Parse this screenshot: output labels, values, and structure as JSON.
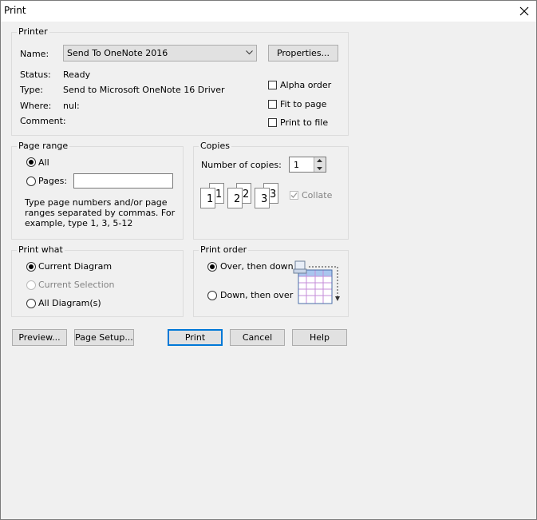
{
  "window": {
    "title": "Print"
  },
  "printer": {
    "group_label": "Printer",
    "name_label": "Name:",
    "name_value": "Send To OneNote 2016",
    "properties_button": "Properties...",
    "status_label": "Status:",
    "status_value": "Ready",
    "type_label": "Type:",
    "type_value": "Send to Microsoft OneNote 16 Driver",
    "where_label": "Where:",
    "where_value": "nul:",
    "comment_label": "Comment:",
    "alpha_order": "Alpha order",
    "fit_to_page": "Fit to page",
    "print_to_file": "Print to file"
  },
  "page_range": {
    "group_label": "Page range",
    "all_label": "All",
    "pages_label": "Pages:",
    "pages_value": "",
    "help_text_1": "Type page numbers and/or page",
    "help_text_2": "ranges separated by commas. For",
    "help_text_3": "example, type 1, 3, 5-12"
  },
  "copies": {
    "group_label": "Copies",
    "number_label": "Number of copies:",
    "number_value": "1",
    "collate_label": "Collate",
    "collate_icon_digits": [
      "1",
      "1",
      "2",
      "2",
      "3",
      "3"
    ]
  },
  "print_what": {
    "group_label": "Print what",
    "current_diagram": "Current Diagram",
    "current_selection": "Current Selection",
    "all_diagrams": "All Diagram(s)"
  },
  "print_order": {
    "group_label": "Print order",
    "over_then_down": "Over, then down",
    "down_then_over": "Down, then over"
  },
  "buttons": {
    "preview": "Preview...",
    "page_setup": "Page Setup...",
    "print": "Print",
    "cancel": "Cancel",
    "help": "Help"
  }
}
